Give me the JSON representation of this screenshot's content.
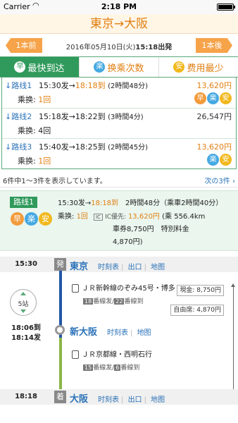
{
  "status": {
    "carrier": "Carrier",
    "time": "2:18 PM"
  },
  "nav": {
    "title": "東京→大阪"
  },
  "date_row": {
    "prev": "1本前",
    "date": "2016年05月10日(火)",
    "time": "15:18出発",
    "next": "1本後"
  },
  "tabs": [
    {
      "icon": "早",
      "label": "最快到达"
    },
    {
      "icon": "楽",
      "label": "换乘次数"
    },
    {
      "icon": "安",
      "label": "费用最少"
    }
  ],
  "routes": [
    {
      "label": "路线1",
      "depart": "15:30发",
      "arrive": "18:18到",
      "duration": "(2時間48分)",
      "fare": "13,620円",
      "transfer_label": "乘换:",
      "transfers": "1回",
      "badges": [
        "早",
        "楽",
        "安"
      ]
    },
    {
      "label": "路线2",
      "depart": "15:18发",
      "arrive": "18:22到",
      "duration": "(3時間4分)",
      "fare": "26,547円",
      "transfer_label": "乘换:",
      "transfers": "4回",
      "badges": []
    },
    {
      "label": "路线3",
      "depart": "15:40发",
      "arrive": "18:25到",
      "duration": "(2時間45分)",
      "fare": "13,620円",
      "transfer_label": "乘换:",
      "transfers": "1回",
      "badges": [
        "楽",
        "安"
      ]
    }
  ],
  "pager": {
    "info": "6件中1～3件を表示しています。",
    "more": "次の3件"
  },
  "summary": {
    "chip": "路线1",
    "depart": "15:30发",
    "arrive": "18:18到",
    "duration": "2時間48分（乘車2時間40分）",
    "transfer_label": "乘换:",
    "transfers": "1回",
    "ic_label": "IC優先:",
    "ic_fare": "13,620円",
    "distance": "(乘 556.4km",
    "ticket": "車券8,750円　特別料金",
    "surcharge": "4,870円)",
    "badges": [
      "早",
      "楽",
      "安"
    ]
  },
  "timeline": {
    "stations": [
      {
        "time": "15:30",
        "mark": "発",
        "name": "東京"
      },
      {
        "time": "18:06到",
        "time2": "18:14发",
        "name": "新大阪"
      },
      {
        "time": "18:18",
        "mark": "着",
        "name": "大阪"
      }
    ],
    "links": [
      "时刻表",
      "出口",
      "地图"
    ],
    "links_short": [
      "时刻表",
      "地图"
    ],
    "segments": [
      {
        "train": "ＪＲ新幹線のぞみ45号・博多",
        "plat_from_num": "18",
        "plat_from": "番線发",
        "plat_to_num": "22",
        "plat_to": "番線到"
      },
      {
        "train": "ＪＲ京都線・西明石行",
        "plat_from_num": "15",
        "plat_from": "番線发",
        "plat_to_num": "6",
        "plat_to": "番線到"
      }
    ],
    "stops": "5站",
    "cash_label": "現金:",
    "cash": "8,750円",
    "reserved_label": "自由席:",
    "reserved": "4,870円"
  },
  "colors": {
    "green": "#2f9a5b",
    "orange": "#e07f12",
    "blue": "#2b72b8",
    "shinkansen": "#2256a8",
    "jr_line": "#8ab547"
  }
}
